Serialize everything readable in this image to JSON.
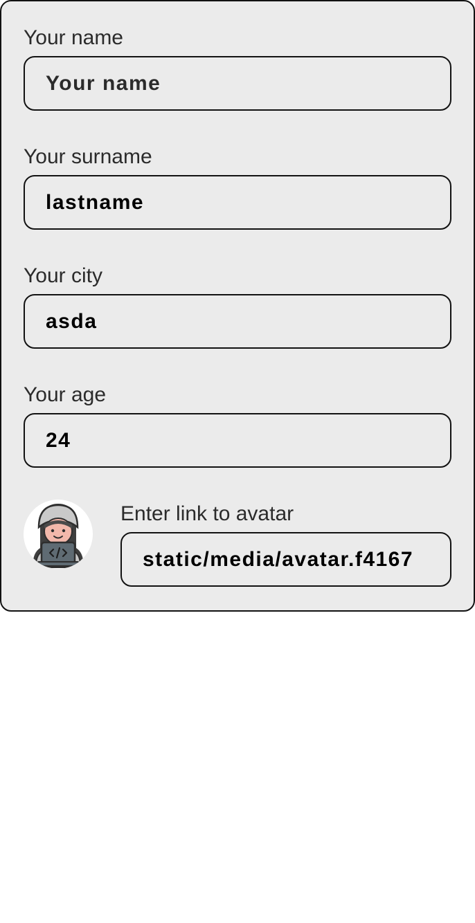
{
  "form": {
    "name": {
      "label": "Your name",
      "placeholder": "Your name",
      "value": ""
    },
    "surname": {
      "label": "Your surname",
      "placeholder": "Your surname",
      "value": "lastname"
    },
    "city": {
      "label": "Your city",
      "placeholder": "Your city",
      "value": "asda"
    },
    "age": {
      "label": "Your age",
      "placeholder": "Your age",
      "value": "24"
    },
    "avatar_link": {
      "label": "Enter link to avatar",
      "placeholder": "Enter link to avatar",
      "value": "static/media/avatar.f4167"
    }
  },
  "avatar": {
    "icon": "hooded-coder-avatar-icon"
  }
}
